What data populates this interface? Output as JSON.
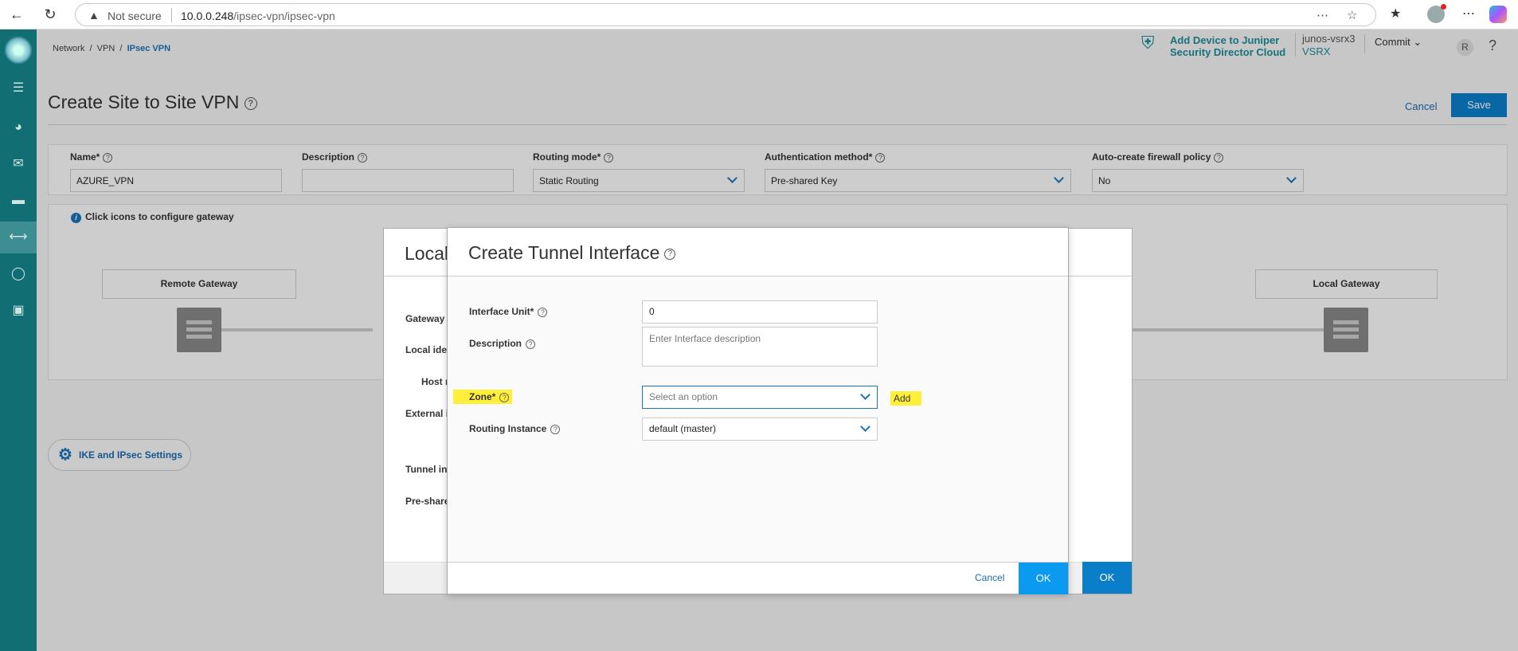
{
  "browser": {
    "security_label": "Not secure",
    "url_host": "10.0.0.248",
    "url_path": "/ipsec-vpn/ipsec-vpn"
  },
  "breadcrumb": {
    "item1": "Network",
    "sep": "/",
    "item2": "VPN",
    "item3": "IPsec VPN"
  },
  "header": {
    "jsdc_line1": "Add Device to Juniper",
    "jsdc_line2": "Security Director Cloud",
    "device_name": "junos-vsrx3",
    "device_type": "VSRX",
    "commit_label": "Commit",
    "user_initial": "R",
    "help": "?"
  },
  "page": {
    "title": "Create Site to Site VPN",
    "cancel": "Cancel",
    "save": "Save"
  },
  "form": {
    "name_label": "Name*",
    "name_value": "AZURE_VPN",
    "desc_label": "Description",
    "desc_value": "",
    "routing_label": "Routing mode*",
    "routing_value": "Static Routing",
    "auth_label": "Authentication method*",
    "auth_value": "Pre-shared Key",
    "fw_label": "Auto-create firewall policy",
    "fw_value": "No"
  },
  "gateway_panel": {
    "info": "Click icons to configure gateway",
    "remote": "Remote Gateway",
    "local": "Local Gateway"
  },
  "ike_button": "IKE and IPsec Settings",
  "back_modal": {
    "title": "Local",
    "labels": [
      "Gateway",
      "Local ide",
      "Host n",
      "External i",
      "Tunnel in",
      "Pre-share"
    ],
    "ok": "OK"
  },
  "modal": {
    "title": "Create Tunnel Interface",
    "unit_label": "Interface Unit*",
    "unit_value": "0",
    "desc_label": "Description",
    "desc_placeholder": "Enter Interface description",
    "zone_label": "Zone*",
    "zone_placeholder": "Select an option",
    "add": "Add",
    "ri_label": "Routing Instance",
    "ri_value": "default (master)",
    "cancel": "Cancel",
    "ok": "OK"
  }
}
